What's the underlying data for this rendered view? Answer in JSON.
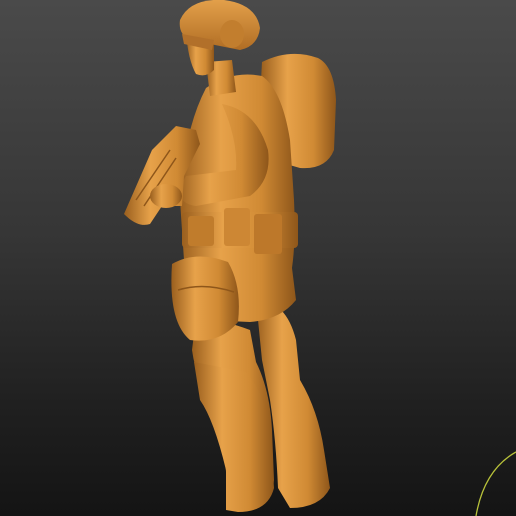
{
  "viewport": {
    "background_top": "#4a4a4a",
    "background_bottom": "#141414"
  },
  "model": {
    "subject": "soldier-figure-sculpt",
    "material_color": "#d08a34",
    "material_highlight": "#e7a24a",
    "material_shadow": "#9a5f1e"
  },
  "gizmo": {
    "color": "#b8c23a"
  }
}
